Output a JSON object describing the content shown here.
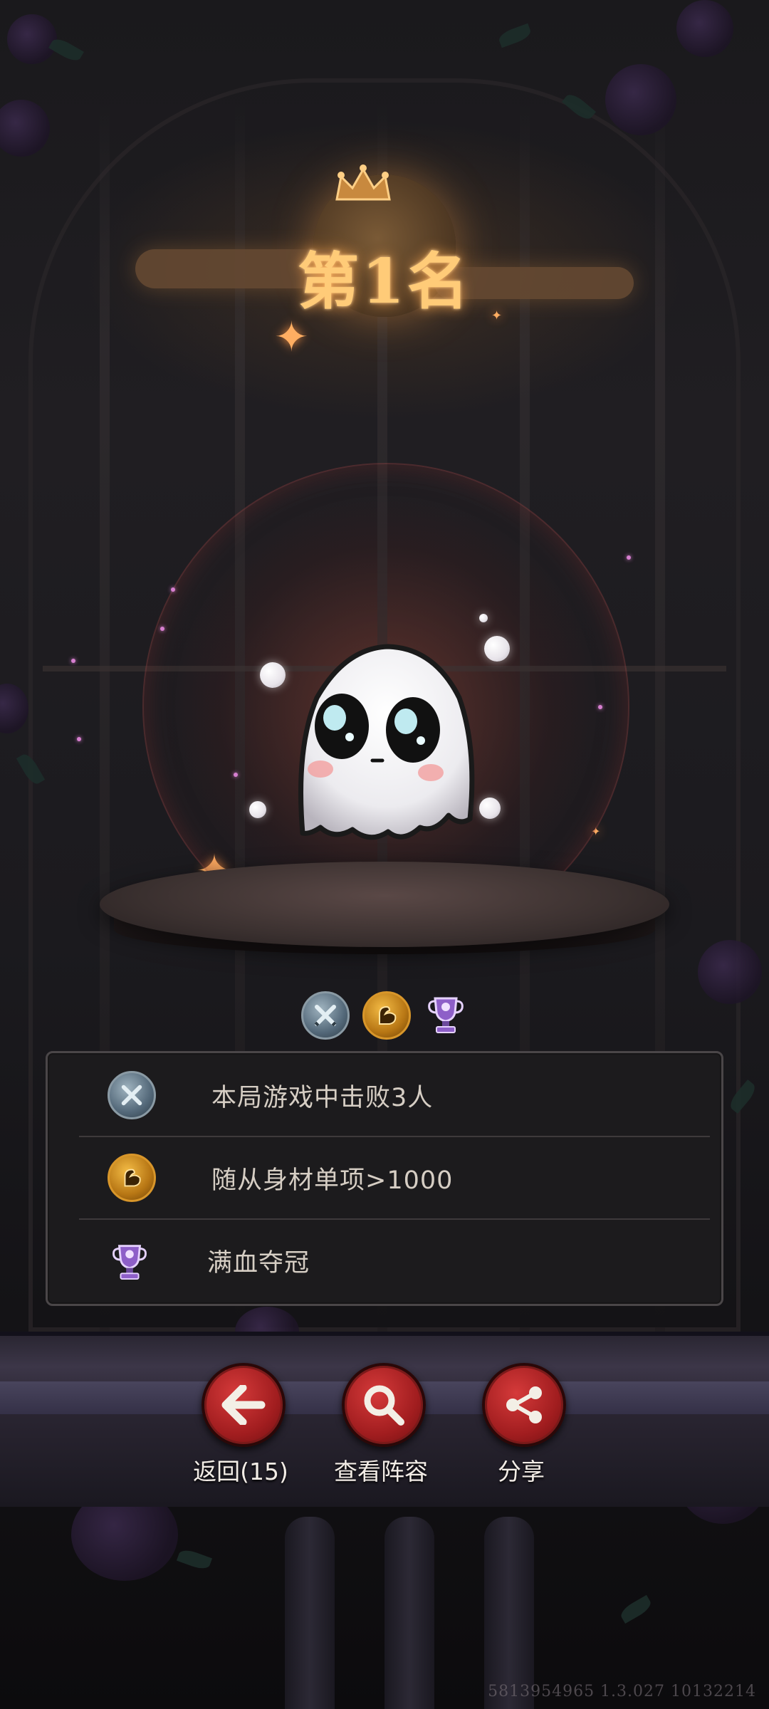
{
  "rank": {
    "title": "第1名"
  },
  "badges": [
    {
      "icon": "crossed-swords-icon"
    },
    {
      "icon": "muscle-arm-icon"
    },
    {
      "icon": "purple-trophy-icon"
    }
  ],
  "achievements": [
    {
      "icon": "crossed-swords-icon",
      "text": "本局游戏中击败3人"
    },
    {
      "icon": "muscle-arm-icon",
      "text": "随从身材单项>1000"
    },
    {
      "icon": "purple-trophy-icon",
      "text": "满血夺冠"
    }
  ],
  "actions": {
    "back_label": "返回(15)",
    "view_lineup_label": "查看阵容",
    "share_label": "分享"
  },
  "footer": {
    "build_id": "5813954965 1.3.027 10132214"
  },
  "colors": {
    "title_glow": "#ffcb78",
    "button_red": "#a11d1f",
    "panel_bg": "#1c1b1d",
    "text": "#d6cec4"
  }
}
